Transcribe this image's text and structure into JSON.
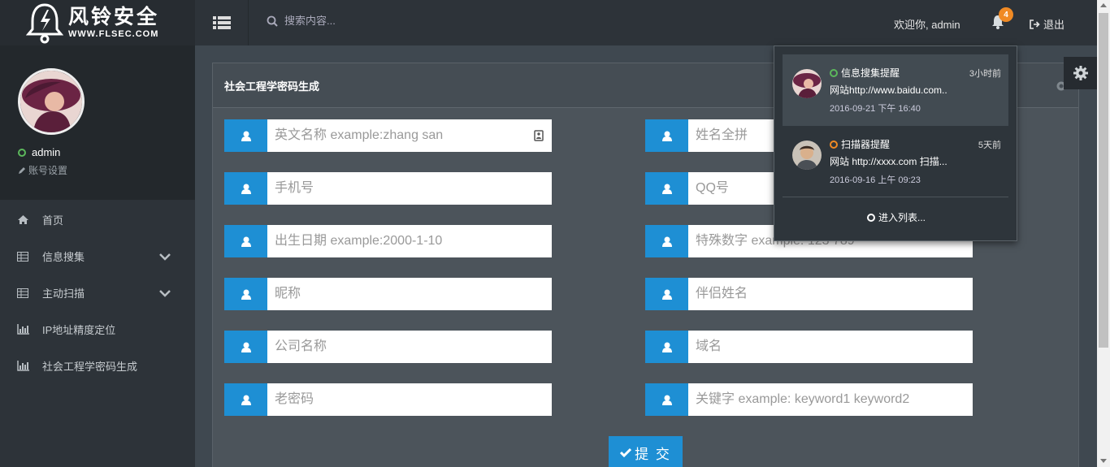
{
  "brand": {
    "name_cn": "风铃安全",
    "url": "WWW.FLSEC.COM"
  },
  "user": {
    "name": "admin",
    "account_settings": "账号设置",
    "status_color": "#5cb85c"
  },
  "nav": [
    {
      "label": "首页",
      "icon": "home-icon"
    },
    {
      "label": "信息搜集",
      "icon": "table-icon",
      "expandable": true
    },
    {
      "label": "主动扫描",
      "icon": "table-icon",
      "expandable": true
    },
    {
      "label": "IP地址精度定位",
      "icon": "bar-chart-icon"
    },
    {
      "label": "社会工程学密码生成",
      "icon": "bar-chart-icon"
    }
  ],
  "topbar": {
    "search_placeholder": "搜索内容...",
    "welcome": "欢迎你, admin",
    "notification_count": "4",
    "logout": "退出"
  },
  "panel": {
    "title": "社会工程学密码生成",
    "fields_left": [
      {
        "placeholder": "英文名称 example:zhang san"
      },
      {
        "placeholder": "手机号"
      },
      {
        "placeholder": "出生日期 example:2000-1-10"
      },
      {
        "placeholder": "昵称"
      },
      {
        "placeholder": "公司名称"
      },
      {
        "placeholder": "老密码"
      }
    ],
    "fields_right": [
      {
        "placeholder": "姓名全拼"
      },
      {
        "placeholder": "QQ号"
      },
      {
        "placeholder": "特殊数字 example: 123 789"
      },
      {
        "placeholder": "伴侣姓名"
      },
      {
        "placeholder": "域名"
      },
      {
        "placeholder": "关键字 example: keyword1 keyword2"
      }
    ],
    "submit": "提 交"
  },
  "notifications": {
    "items": [
      {
        "title": "信息搜集提醒",
        "time": "3小时前",
        "message": "网站http://www.baidu.com..",
        "date": "2016-09-21 下午 16:40",
        "status_color": "#5cb85c"
      },
      {
        "title": "扫描器提醒",
        "time": "5天前",
        "message": "网站 http://xxxx.com 扫描...",
        "date": "2016-09-16 上午 09:23",
        "status_color": "#f08a24"
      }
    ],
    "view_all": "进入列表..."
  },
  "colors": {
    "accent": "#1e8fd4",
    "badge": "#f08a24",
    "sidebar": "#2d3339"
  }
}
